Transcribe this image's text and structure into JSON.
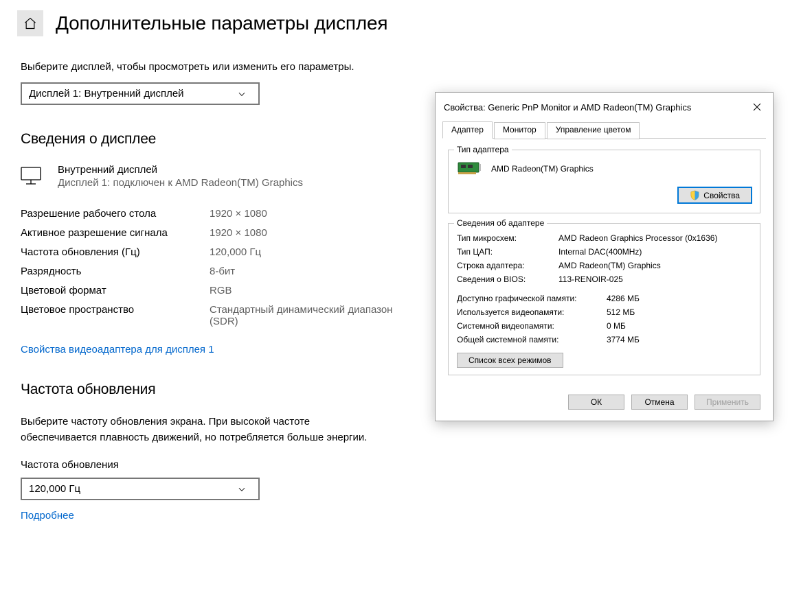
{
  "page": {
    "title": "Дополнительные параметры дисплея",
    "select_instruction": "Выберите дисплей, чтобы просмотреть или изменить его параметры.",
    "display_selector": "Дисплей 1: Внутренний дисплей",
    "display_info_heading": "Сведения о дисплее",
    "display_name": "Внутренний дисплей",
    "display_sub": "Дисплей 1: подключен к AMD Radeon(TM) Graphics",
    "specs": [
      {
        "label": "Разрешение рабочего стола",
        "value": "1920 × 1080"
      },
      {
        "label": "Активное разрешение сигнала",
        "value": "1920 × 1080"
      },
      {
        "label": "Частота обновления (Гц)",
        "value": "120,000 Гц"
      },
      {
        "label": "Разрядность",
        "value": "8-бит"
      },
      {
        "label": "Цветовой формат",
        "value": "RGB"
      },
      {
        "label": "Цветовое пространство",
        "value": "Стандартный динамический диапазон (SDR)"
      }
    ],
    "adapter_props_link": "Свойства видеоадаптера для дисплея 1",
    "refresh_heading": "Частота обновления",
    "refresh_desc": "Выберите частоту обновления экрана. При высокой частоте обеспечивается плавность движений, но потребляется больше энергии.",
    "refresh_label": "Частота обновления",
    "refresh_value": "120,000 Гц",
    "more_link": "Подробнее"
  },
  "dialog": {
    "title": "Свойства: Generic PnP Monitor и AMD Radeon(TM) Graphics",
    "tabs": {
      "adapter": "Адаптер",
      "monitor": "Монитор",
      "color": "Управление цветом"
    },
    "adapter_type_legend": "Тип адаптера",
    "adapter_name": "AMD Radeon(TM) Graphics",
    "properties_btn": "Свойства",
    "adapter_info_legend": "Сведения об адаптере",
    "info": [
      {
        "label": "Тип микросхем:",
        "value": "AMD Radeon Graphics Processor (0x1636)"
      },
      {
        "label": "Тип ЦАП:",
        "value": "Internal DAC(400MHz)"
      },
      {
        "label": "Строка адаптера:",
        "value": "AMD Radeon(TM) Graphics"
      },
      {
        "label": "Сведения о BIOS:",
        "value": "113-RENOIR-025"
      }
    ],
    "mem": [
      {
        "label": "Доступно графической памяти:",
        "value": "4286 МБ"
      },
      {
        "label": "Используется видеопамяти:",
        "value": "512 МБ"
      },
      {
        "label": "Системной видеопамяти:",
        "value": "0 МБ"
      },
      {
        "label": "Общей системной памяти:",
        "value": "3774 МБ"
      }
    ],
    "list_modes_btn": "Список всех режимов",
    "footer": {
      "ok": "ОК",
      "cancel": "Отмена",
      "apply": "Применить"
    }
  }
}
